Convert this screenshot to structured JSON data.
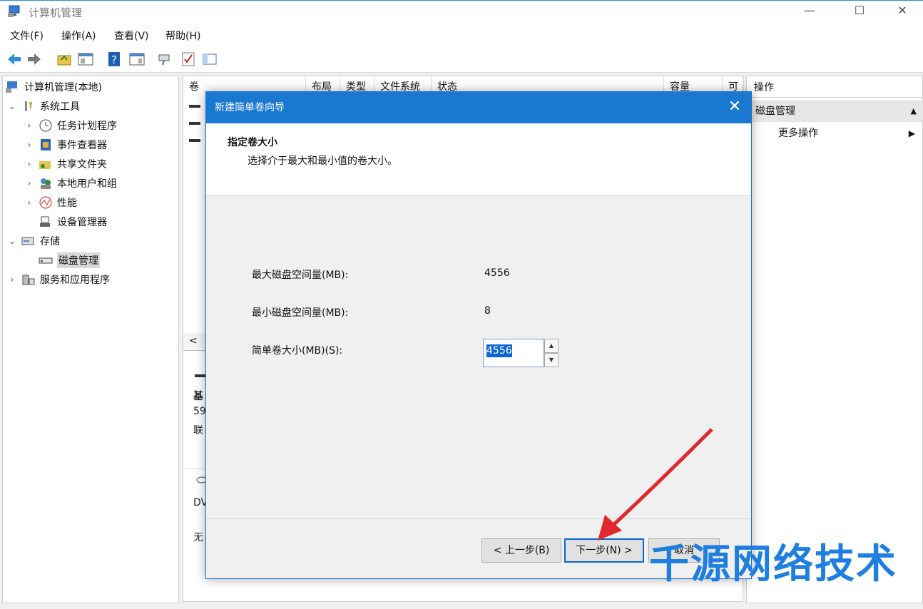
{
  "window": {
    "title": "计算机管理",
    "minimize": "—",
    "maximize": "☐",
    "close": "✕"
  },
  "menu": [
    "文件(F)",
    "操作(A)",
    "查看(V)",
    "帮助(H)"
  ],
  "tree": {
    "root": "计算机管理(本地)",
    "items": [
      {
        "label": "系统工具",
        "arrow": "⌄",
        "icon": "tools-icon"
      },
      {
        "label": "任务计划程序",
        "arrow": "›",
        "icon": "clock-icon"
      },
      {
        "label": "事件查看器",
        "arrow": "›",
        "icon": "event-viewer-icon"
      },
      {
        "label": "共享文件夹",
        "arrow": "›",
        "icon": "shared-folder-icon"
      },
      {
        "label": "本地用户和组",
        "arrow": "›",
        "icon": "users-icon"
      },
      {
        "label": "性能",
        "arrow": "›",
        "icon": "performance-icon"
      },
      {
        "label": "设备管理器",
        "arrow": "",
        "icon": "device-manager-icon"
      },
      {
        "label": "存储",
        "arrow": "⌄",
        "icon": "storage-icon"
      },
      {
        "label": "磁盘管理",
        "arrow": "",
        "icon": "disk-icon"
      },
      {
        "label": "服务和应用程序",
        "arrow": "›",
        "icon": "services-icon"
      }
    ]
  },
  "columns": [
    "卷",
    "布局",
    "类型",
    "文件系统",
    "状态",
    "容量",
    "可"
  ],
  "center_fragments": {
    "scroll_left": "<",
    "a": "基",
    "b": "59",
    "c": "联",
    "d": "DV",
    "e": "无"
  },
  "actions": {
    "header": "操作",
    "section": "磁盘管理",
    "section_arrow": "▲",
    "more": "更多操作",
    "more_arrow": "▶"
  },
  "dialog": {
    "title": "新建简单卷向导",
    "close": "✕",
    "heading": "指定卷大小",
    "subheading": "选择介于最大和最小值的卷大小。",
    "max_label": "最大磁盘空间量(MB):",
    "max_value": "4556",
    "min_label": "最小磁盘空间量(MB):",
    "min_value": "8",
    "size_label": "简单卷大小(MB)(S):",
    "size_value": "4556",
    "back": "< 上一步(B)",
    "next": "下一步(N) >",
    "cancel": "取消"
  },
  "watermark": "千源网络技术",
  "colors": {
    "dialog_title_bg": "#1978d0",
    "accent": "#0a64d6",
    "annotation_arrow": "#e0282e",
    "watermark": "#1e7fe0"
  }
}
